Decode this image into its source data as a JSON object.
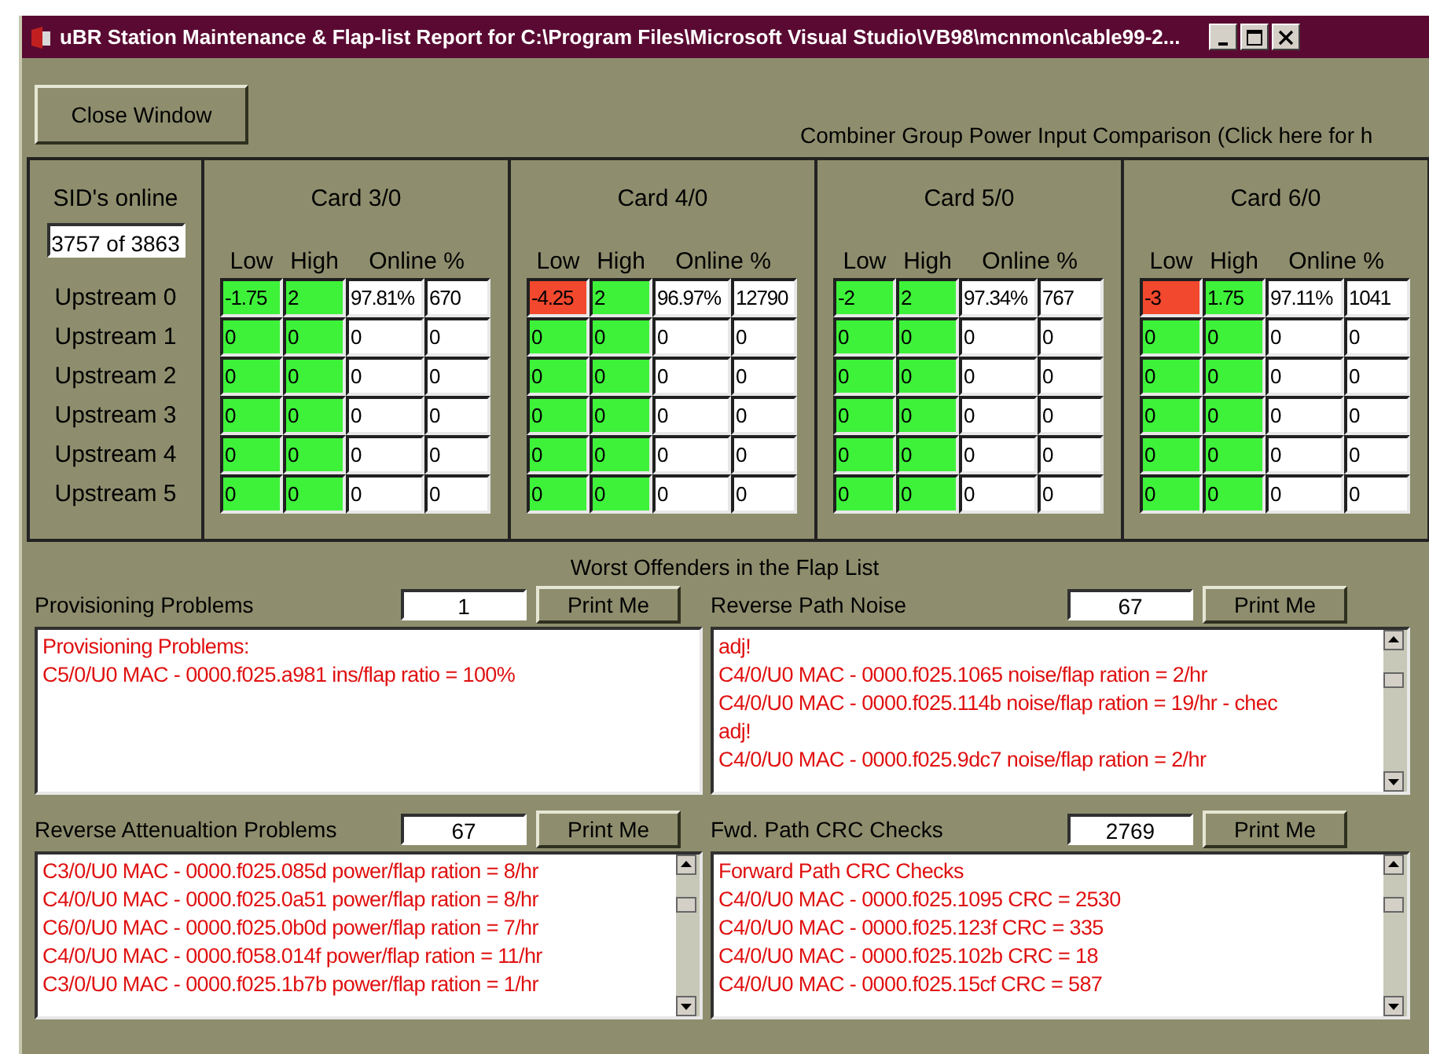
{
  "window": {
    "title": "uBR Station Maintenance & Flap-list Report for C:\\Program Files\\Microsoft Visual Studio\\VB98\\mcnmon\\cable99-2..."
  },
  "close_button": "Close Window",
  "combiner_link": "Combiner Group Power Input Comparison (Click here for h",
  "sids": {
    "label": "SID's online",
    "value": "3757 of 3863",
    "upstreams": [
      "Upstream 0",
      "Upstream 1",
      "Upstream 2",
      "Upstream 3",
      "Upstream 4",
      "Upstream 5"
    ]
  },
  "cards": [
    {
      "title": "Card 3/0",
      "columns": [
        "Low",
        "High",
        "Online %"
      ],
      "rows": [
        {
          "low": {
            "value": "-1.75",
            "alarm": false
          },
          "high": {
            "value": "2",
            "alarm": false
          },
          "online": "97.81%",
          "count": "670"
        },
        {
          "low": {
            "value": "0",
            "alarm": false
          },
          "high": {
            "value": "0",
            "alarm": false
          },
          "online": "0",
          "count": "0"
        },
        {
          "low": {
            "value": "0",
            "alarm": false
          },
          "high": {
            "value": "0",
            "alarm": false
          },
          "online": "0",
          "count": "0"
        },
        {
          "low": {
            "value": "0",
            "alarm": false
          },
          "high": {
            "value": "0",
            "alarm": false
          },
          "online": "0",
          "count": "0"
        },
        {
          "low": {
            "value": "0",
            "alarm": false
          },
          "high": {
            "value": "0",
            "alarm": false
          },
          "online": "0",
          "count": "0"
        },
        {
          "low": {
            "value": "0",
            "alarm": false
          },
          "high": {
            "value": "0",
            "alarm": false
          },
          "online": "0",
          "count": "0"
        }
      ]
    },
    {
      "title": "Card 4/0",
      "columns": [
        "Low",
        "High",
        "Online %"
      ],
      "rows": [
        {
          "low": {
            "value": "-4.25",
            "alarm": true
          },
          "high": {
            "value": "2",
            "alarm": false
          },
          "online": "96.97%",
          "count": "12790"
        },
        {
          "low": {
            "value": "0",
            "alarm": false
          },
          "high": {
            "value": "0",
            "alarm": false
          },
          "online": "0",
          "count": "0"
        },
        {
          "low": {
            "value": "0",
            "alarm": false
          },
          "high": {
            "value": "0",
            "alarm": false
          },
          "online": "0",
          "count": "0"
        },
        {
          "low": {
            "value": "0",
            "alarm": false
          },
          "high": {
            "value": "0",
            "alarm": false
          },
          "online": "0",
          "count": "0"
        },
        {
          "low": {
            "value": "0",
            "alarm": false
          },
          "high": {
            "value": "0",
            "alarm": false
          },
          "online": "0",
          "count": "0"
        },
        {
          "low": {
            "value": "0",
            "alarm": false
          },
          "high": {
            "value": "0",
            "alarm": false
          },
          "online": "0",
          "count": "0"
        }
      ]
    },
    {
      "title": "Card 5/0",
      "columns": [
        "Low",
        "High",
        "Online %"
      ],
      "rows": [
        {
          "low": {
            "value": "-2",
            "alarm": false
          },
          "high": {
            "value": "2",
            "alarm": false
          },
          "online": "97.34%",
          "count": "767"
        },
        {
          "low": {
            "value": "0",
            "alarm": false
          },
          "high": {
            "value": "0",
            "alarm": false
          },
          "online": "0",
          "count": "0"
        },
        {
          "low": {
            "value": "0",
            "alarm": false
          },
          "high": {
            "value": "0",
            "alarm": false
          },
          "online": "0",
          "count": "0"
        },
        {
          "low": {
            "value": "0",
            "alarm": false
          },
          "high": {
            "value": "0",
            "alarm": false
          },
          "online": "0",
          "count": "0"
        },
        {
          "low": {
            "value": "0",
            "alarm": false
          },
          "high": {
            "value": "0",
            "alarm": false
          },
          "online": "0",
          "count": "0"
        },
        {
          "low": {
            "value": "0",
            "alarm": false
          },
          "high": {
            "value": "0",
            "alarm": false
          },
          "online": "0",
          "count": "0"
        }
      ]
    },
    {
      "title": "Card 6/0",
      "columns": [
        "Low",
        "High",
        "Online %"
      ],
      "rows": [
        {
          "low": {
            "value": "-3",
            "alarm": true
          },
          "high": {
            "value": "1.75",
            "alarm": false
          },
          "online": "97.11%",
          "count": "1041"
        },
        {
          "low": {
            "value": "0",
            "alarm": false
          },
          "high": {
            "value": "0",
            "alarm": false
          },
          "online": "0",
          "count": "0"
        },
        {
          "low": {
            "value": "0",
            "alarm": false
          },
          "high": {
            "value": "0",
            "alarm": false
          },
          "online": "0",
          "count": "0"
        },
        {
          "low": {
            "value": "0",
            "alarm": false
          },
          "high": {
            "value": "0",
            "alarm": false
          },
          "online": "0",
          "count": "0"
        },
        {
          "low": {
            "value": "0",
            "alarm": false
          },
          "high": {
            "value": "0",
            "alarm": false
          },
          "online": "0",
          "count": "0"
        },
        {
          "low": {
            "value": "0",
            "alarm": false
          },
          "high": {
            "value": "0",
            "alarm": false
          },
          "online": "0",
          "count": "0"
        }
      ]
    }
  ],
  "flap_heading": "Worst Offenders in the Flap List",
  "flap_panels": [
    {
      "label": "Provisioning Problems",
      "count": "1",
      "button": "Print Me",
      "scrollbar": false,
      "lines": [
        "Provisioning Problems:",
        "C5/0/U0  MAC - 0000.f025.a981  ins/flap ratio = 100%"
      ]
    },
    {
      "label": "Reverse Path Noise",
      "count": "67",
      "button": "Print Me",
      "scrollbar": true,
      "lines": [
        "adj!",
        "C4/0/U0 MAC - 0000.f025.1065  noise/flap ration = 2/hr",
        "C4/0/U0 MAC - 0000.f025.114b  noise/flap ration = 19/hr - chec",
        "adj!",
        "C4/0/U0 MAC - 0000.f025.9dc7  noise/flap ration = 2/hr"
      ]
    },
    {
      "label": "Reverse Attenualtion Problems",
      "count": "67",
      "button": "Print Me",
      "scrollbar": true,
      "lines": [
        "C3/0/U0 MAC - 0000.f025.085d  power/flap ration = 8/hr",
        "C4/0/U0 MAC - 0000.f025.0a51  power/flap ration = 8/hr",
        "C6/0/U0 MAC - 0000.f025.0b0d  power/flap ration = 7/hr",
        "C4/0/U0 MAC - 0000.f058.014f  power/flap ration = 11/hr",
        "C3/0/U0 MAC - 0000.f025.1b7b  power/flap ration = 1/hr"
      ]
    },
    {
      "label": "Fwd. Path CRC Checks",
      "count": "2769",
      "button": "Print Me",
      "scrollbar": true,
      "lines": [
        "Forward Path CRC Checks",
        "C4/0/U0 MAC - 0000.f025.1095  CRC = 2530",
        "C4/0/U0 MAC - 0000.f025.123f  CRC = 335",
        "C4/0/U0 MAC - 0000.f025.102b  CRC = 18",
        "C4/0/U0 MAC - 0000.f025.15cf  CRC = 587"
      ]
    }
  ]
}
